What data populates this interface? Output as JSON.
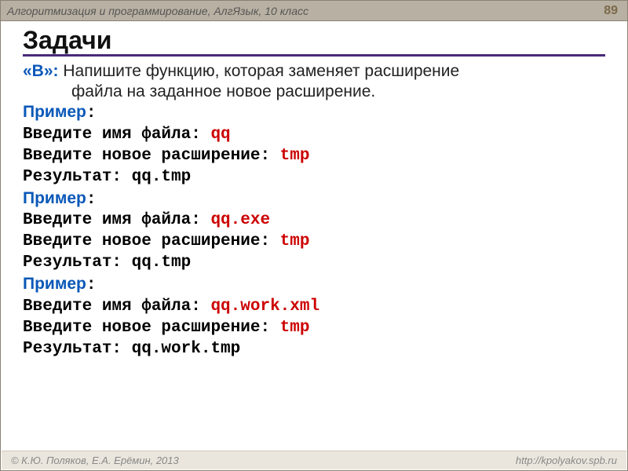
{
  "header": {
    "title": "Алгоритмизация и программирование, АлгЯзык, 10 класс",
    "page": "89"
  },
  "heading": "Задачи",
  "task": {
    "label": "«B»:",
    "line1": " Напишите функцию, которая заменяет расширение",
    "line2": "файла на заданное новое расширение."
  },
  "prompts": {
    "name": "Введите имя файла: ",
    "ext": "Введите новое расширение: ",
    "res": "Результат: "
  },
  "exampleLabel": "Пример",
  "colon": ":",
  "examples": [
    {
      "file": "qq",
      "ext": "tmp",
      "result": "qq.tmp"
    },
    {
      "file": "qq.exe",
      "ext": "tmp",
      "result": "qq.tmp"
    },
    {
      "file": "qq.work.xml",
      "ext": "tmp",
      "result": "qq.work.tmp"
    }
  ],
  "footer": {
    "left": "© К.Ю. Поляков, Е.А. Ерёмин, 2013",
    "right": "http://kpolyakov.spb.ru"
  }
}
